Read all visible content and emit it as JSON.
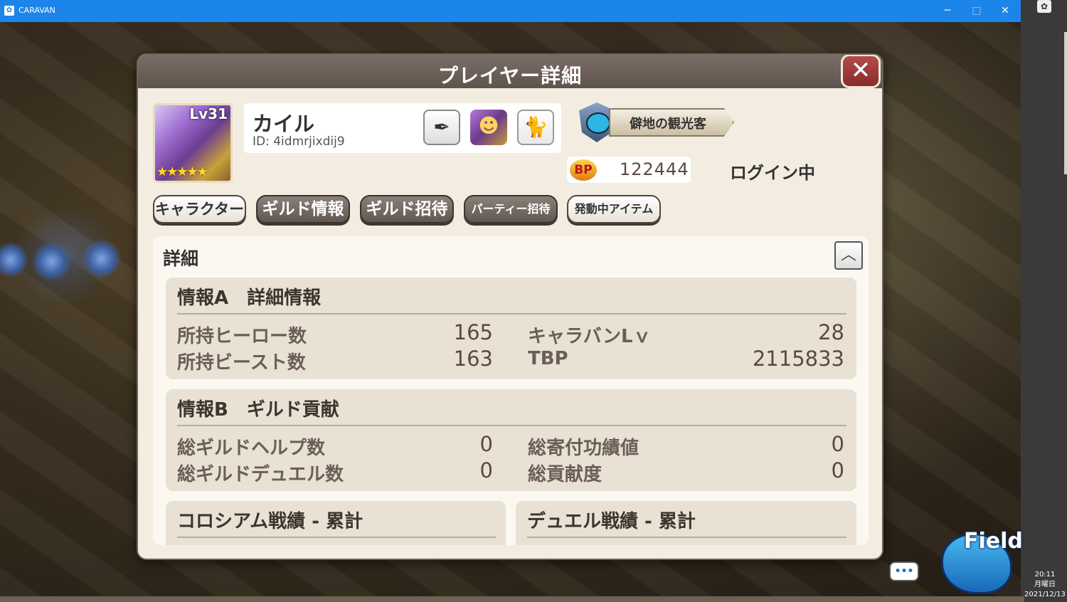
{
  "window": {
    "title": "CARAVAN",
    "minimize": "─",
    "maximize": "□",
    "close": "✕"
  },
  "taskbar": {
    "time": "20:11",
    "weekday": "月曜日",
    "date": "2021/12/13"
  },
  "dialog": {
    "title": "プレイヤー詳細",
    "close_glyph": "✕",
    "player": {
      "level": "Lv31",
      "stars": "★★★★★",
      "name": "カイル",
      "id": "ID: 4idmrjixdij9"
    },
    "rank_title": "僻地の観光客",
    "bp": {
      "icon_label": "BP",
      "value": "122444"
    },
    "status": "ログイン中",
    "tabs": [
      {
        "label": "キャラクター",
        "style": "light"
      },
      {
        "label": "ギルド情報",
        "style": "dark"
      },
      {
        "label": "ギルド招待",
        "style": "dark"
      },
      {
        "label": "パーティー招待",
        "style": "dark"
      },
      {
        "label": "発動中アイテム",
        "style": "light"
      }
    ],
    "details": {
      "title": "詳細",
      "collapse_glyph": "︿",
      "sectionA": {
        "title": "情報A　詳細情報",
        "rows": [
          {
            "label": "所持ヒーロー数",
            "value": "165",
            "label2": "キャラバンLｖ",
            "value2": "28"
          },
          {
            "label": "所持ビースト数",
            "value": "163",
            "label2": "TBP",
            "value2": "2115833"
          }
        ]
      },
      "sectionB": {
        "title": "情報B　ギルド貢献",
        "rows": [
          {
            "label": "総ギルドヘルプ数",
            "value": "0",
            "label2": "総寄付功績値",
            "value2": "0"
          },
          {
            "label": "総ギルドデュエル数",
            "value": "0",
            "label2": "総貢献度",
            "value2": "0"
          }
        ]
      },
      "sectionC": {
        "title": "コロシアム戦績 - 累計"
      },
      "sectionD": {
        "title": "デュエル戦績 - 累計"
      }
    }
  },
  "overlay": {
    "chat_glyph": "•••",
    "field_label": "Field"
  }
}
